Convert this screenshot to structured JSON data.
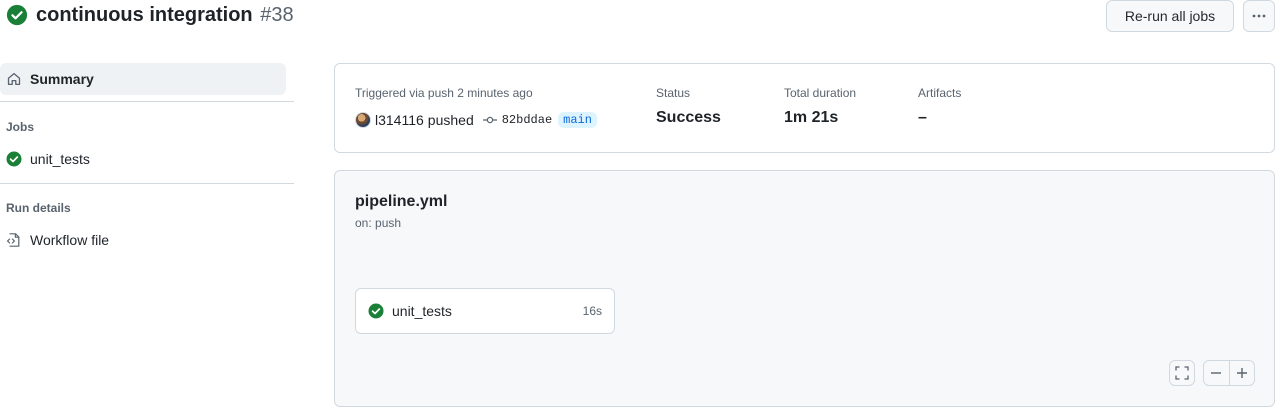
{
  "header": {
    "title": "continuous integration",
    "run_number": "#38",
    "rerun_label": "Re-run all jobs",
    "more_label": "···",
    "status": "success"
  },
  "sidebar": {
    "summary_label": "Summary",
    "jobs_heading": "Jobs",
    "jobs": [
      {
        "label": "unit_tests",
        "status": "success"
      }
    ],
    "run_details_heading": "Run details",
    "workflow_file_label": "Workflow file"
  },
  "summary": {
    "trigger_text": "Triggered via push 2 minutes ago",
    "actor": "l314116",
    "action": "pushed",
    "commit_sha": "82bddae",
    "branch": "main",
    "status_label": "Status",
    "status_value": "Success",
    "duration_label": "Total duration",
    "duration_value": "1m 21s",
    "artifacts_label": "Artifacts",
    "artifacts_value": "–"
  },
  "graph": {
    "workflow_name": "pipeline.yml",
    "workflow_trigger": "on: push",
    "jobs": [
      {
        "label": "unit_tests",
        "duration": "16s",
        "status": "success"
      }
    ]
  },
  "colors": {
    "success": "#1a7f37",
    "branch_text": "#0969da",
    "branch_bg": "#ddf4ff",
    "border": "#d1d9e0",
    "muted": "#59636e"
  },
  "icons": {
    "run_status": "check-circle-fill-icon",
    "summary": "home-icon",
    "job_status": "check-circle-fill-icon",
    "workflow_file": "file-code-icon",
    "commit": "git-commit-icon",
    "fullscreen": "screen-full-icon",
    "zoom_out": "dash-icon",
    "zoom_in": "plus-icon"
  }
}
